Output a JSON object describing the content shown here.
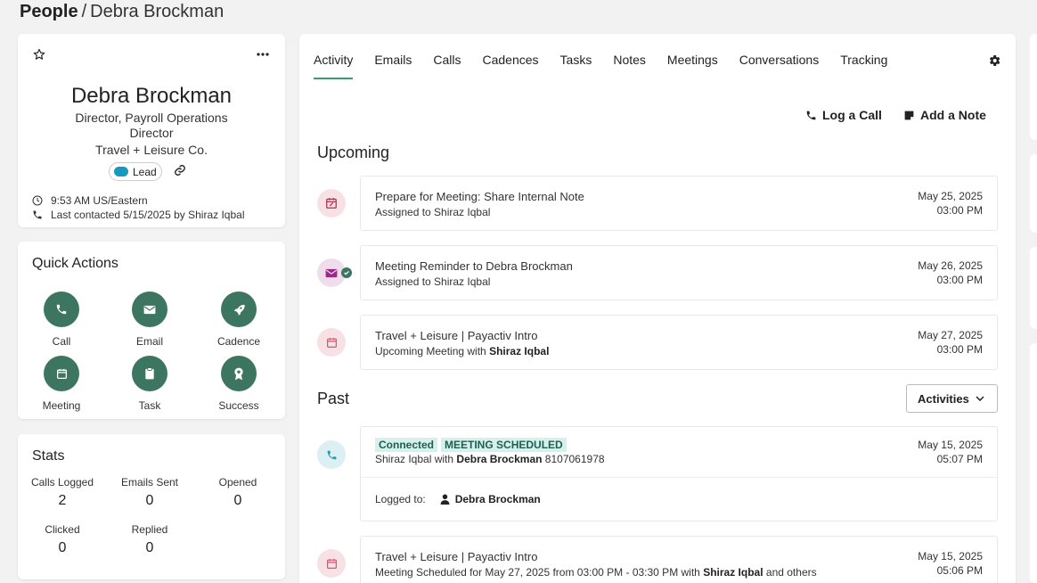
{
  "breadcrumb": {
    "root": "People",
    "separator": "/",
    "current": "Debra Brockman"
  },
  "profile": {
    "name": "Debra Brockman",
    "title": "Director, Payroll Operations",
    "level": "Director",
    "company": "Travel + Leisure Co.",
    "badge": "Lead",
    "time": "9:53 AM",
    "timezone": "US/Eastern",
    "last_contacted": "Last contacted 5/15/2025 by Shiraz Iqbal"
  },
  "quick_actions": {
    "title": "Quick Actions",
    "items": [
      {
        "label": "Call",
        "icon": "phone-icon"
      },
      {
        "label": "Email",
        "icon": "envelope-icon"
      },
      {
        "label": "Cadence",
        "icon": "rocket-icon"
      },
      {
        "label": "Meeting",
        "icon": "calendar-icon"
      },
      {
        "label": "Task",
        "icon": "clipboard-icon"
      },
      {
        "label": "Success",
        "icon": "award-icon"
      }
    ]
  },
  "stats": {
    "title": "Stats",
    "items": [
      {
        "label": "Calls Logged",
        "value": "2"
      },
      {
        "label": "Emails Sent",
        "value": "0"
      },
      {
        "label": "Opened",
        "value": "0"
      },
      {
        "label": "Clicked",
        "value": "0"
      },
      {
        "label": "Replied",
        "value": "0"
      }
    ]
  },
  "tabs": [
    "Activity",
    "Emails",
    "Calls",
    "Cadences",
    "Tasks",
    "Notes",
    "Meetings",
    "Conversations",
    "Tracking"
  ],
  "active_tab": "Activity",
  "actions": {
    "log_call": "Log a Call",
    "add_note": "Add a Note"
  },
  "upcoming": {
    "title": "Upcoming",
    "items": [
      {
        "title": "Prepare for Meeting: Share Internal Note",
        "sub": "Assigned to Shiraz Iqbal",
        "date": "May 25, 2025",
        "time": "03:00 PM"
      },
      {
        "title": "Meeting Reminder to Debra Brockman",
        "sub": "Assigned to Shiraz Iqbal",
        "date": "May 26, 2025",
        "time": "03:00 PM"
      },
      {
        "title": "Travel + Leisure | Payactiv Intro",
        "sub_prefix": "Upcoming Meeting with",
        "sub_bold": "Shiraz Iqbal",
        "date": "May 27, 2025",
        "time": "03:00 PM"
      }
    ]
  },
  "past": {
    "title": "Past",
    "filter": "Activities",
    "call": {
      "tags": [
        "Connected",
        "MEETING SCHEDULED"
      ],
      "caller": "Shiraz Iqbal",
      "with": "with",
      "contact": "Debra Brockman",
      "phone": "8107061978",
      "date": "May 15, 2025",
      "time": "05:07 PM",
      "logged_label": "Logged to:",
      "logged_to": "Debra Brockman"
    },
    "meeting": {
      "title": "Travel + Leisure | Payactiv Intro",
      "sub_prefix": "Meeting Scheduled for May 27, 2025 from 03:00 PM - 03:30 PM with",
      "sub_bold": "Shiraz Iqbal",
      "sub_suffix": "and others",
      "date": "May 15, 2025",
      "time": "05:06 PM"
    }
  },
  "colors": {
    "accent": "#3c7560",
    "tab_underline": "#3e9a72",
    "salesforce": "#1798c1"
  }
}
